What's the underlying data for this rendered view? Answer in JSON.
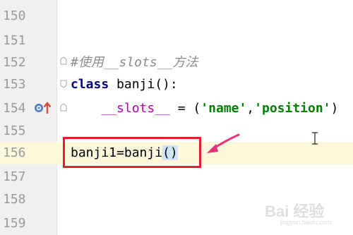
{
  "editor": {
    "lines": [
      {
        "number": "150"
      },
      {
        "number": "151"
      },
      {
        "number": "152",
        "comment": "#使用__slots__方法"
      },
      {
        "number": "153",
        "keyword": "class",
        "rest": " banji():"
      },
      {
        "number": "154",
        "indent": "    ",
        "slots": "__slots__",
        "op": " = (",
        "str1": "'name'",
        "comma": ",",
        "str2": "'position'",
        "close": ")"
      },
      {
        "number": "155"
      },
      {
        "number": "156",
        "code": "banji1=banji",
        "paren": "()"
      },
      {
        "number": "157"
      },
      {
        "number": "158"
      },
      {
        "number": "159"
      }
    ],
    "current_line": "156"
  },
  "icons": {
    "gutter_override": "override-method-icon",
    "fold": "fold-marker-icon",
    "arrow": "pink-arrow-icon",
    "cursor": "text-cursor-icon"
  },
  "colors": {
    "highlight_box": "#e0222f",
    "arrow": "#e8337a",
    "current_line": "#fdf7dc",
    "keyword": "#000080",
    "string": "#008000",
    "magic": "#b200b2",
    "comment": "#8c8c8c"
  },
  "watermark": {
    "logo": "Bai 经验",
    "url": "jingyan.baidu.com"
  }
}
